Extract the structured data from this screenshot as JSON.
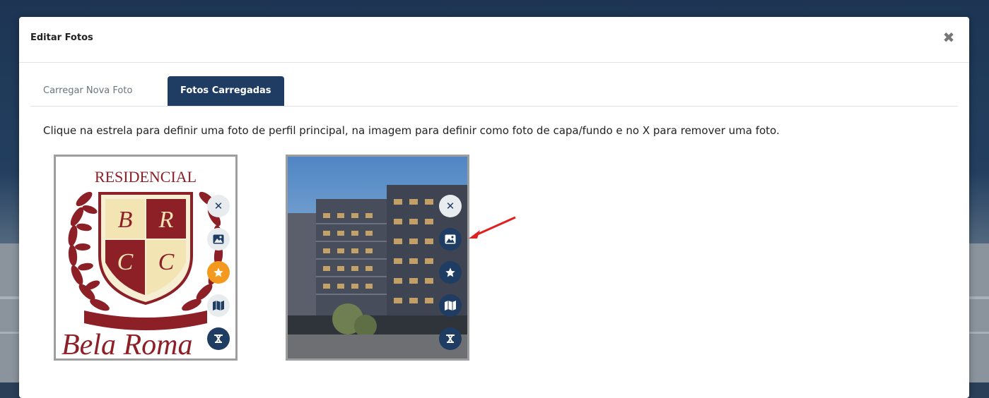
{
  "modal": {
    "title": "Editar Fotos",
    "close_icon": "close-icon"
  },
  "tabs": [
    {
      "label": "Carregar Nova Foto",
      "active": false
    },
    {
      "label": "Fotos Carregadas",
      "active": true
    }
  ],
  "instructions": "Clique na estrela para definir uma foto de perfil principal, na imagem para definir como foto de capa/fundo e no X para remover uma foto.",
  "photos": [
    {
      "logo_text_top": "RESIDENCIAL",
      "logo_letters": [
        "B",
        "R",
        "C",
        "C"
      ],
      "logo_text_bottom": "Bela Roma",
      "buttons": [
        {
          "icon": "close-icon",
          "style": "light"
        },
        {
          "icon": "image-icon",
          "style": "light"
        },
        {
          "icon": "star-icon",
          "style": "orange"
        },
        {
          "icon": "map-icon",
          "style": "light"
        },
        {
          "icon": "tools-icon",
          "style": "dark"
        }
      ]
    },
    {
      "buttons": [
        {
          "icon": "close-icon",
          "style": "light"
        },
        {
          "icon": "image-icon",
          "style": "dark"
        },
        {
          "icon": "star-icon",
          "style": "dark"
        },
        {
          "icon": "map-icon",
          "style": "dark"
        },
        {
          "icon": "tools-icon",
          "style": "dark"
        }
      ]
    }
  ],
  "colors": {
    "primary": "#1f3c63",
    "accent_star": "#f39a1e",
    "annotation_arrow": "#e02020"
  }
}
